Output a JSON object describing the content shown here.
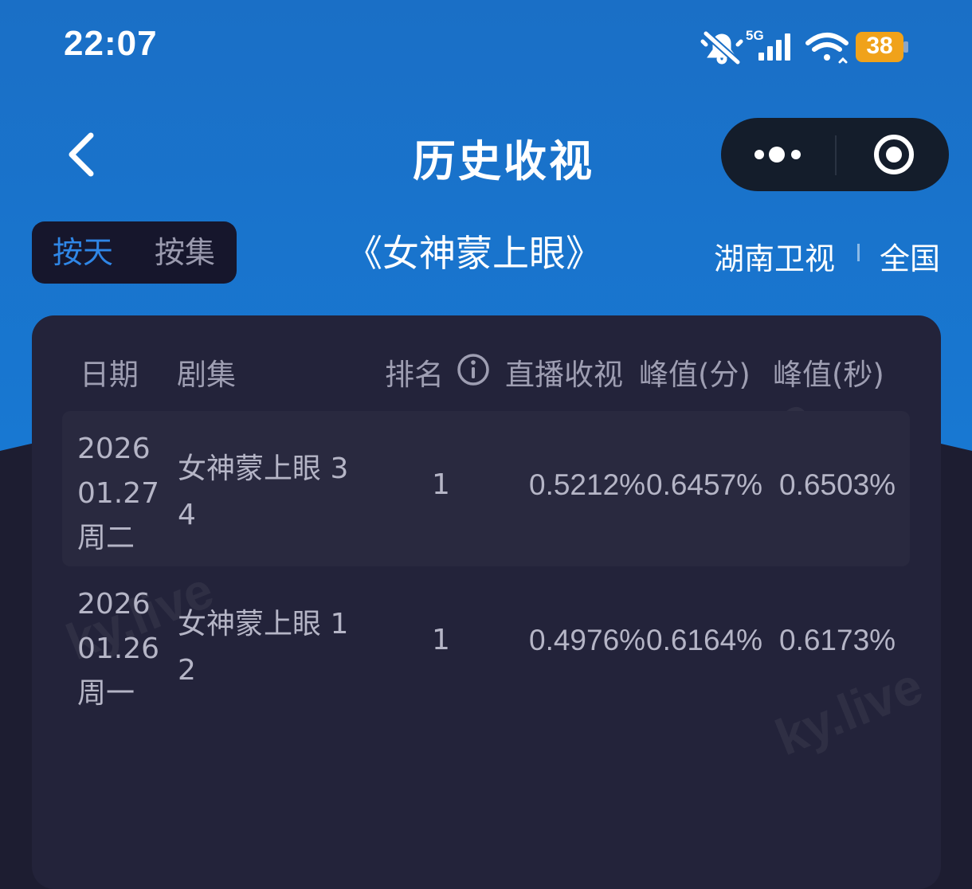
{
  "status_bar": {
    "time": "22:07",
    "network": "5G",
    "battery": "38"
  },
  "nav": {
    "title": "历史收视"
  },
  "controls": {
    "toggle_day": "按天",
    "toggle_episode": "按集",
    "show_title": "《女神蒙上眼》",
    "channel": "湖南卫视",
    "region": "全国"
  },
  "table": {
    "headers": {
      "date": "日期",
      "episode": "剧集",
      "rank": "排名",
      "live_rating": "直播收视",
      "peak_min": "峰值(分)",
      "peak_sec": "峰值(秒)"
    },
    "rows": [
      {
        "year": "2026",
        "date": "01.27",
        "weekday": "周二",
        "episode": "女神蒙上眼 3 4",
        "rank": "1",
        "live": "0.5212%",
        "peak_min": "0.6457%",
        "peak_sec": "0.6503%"
      },
      {
        "year": "2026",
        "date": "01.26",
        "weekday": "周一",
        "episode": "女神蒙上眼 1 2",
        "rank": "1",
        "live": "0.4976%",
        "peak_min": "0.6164%",
        "peak_sec": "0.6173%"
      }
    ]
  },
  "watermark": "ky.live",
  "colors": {
    "header_blue": "#1a72c8",
    "page_bg": "#1d1d31",
    "card_bg": "#23233a",
    "accent": "#2f86e6"
  }
}
